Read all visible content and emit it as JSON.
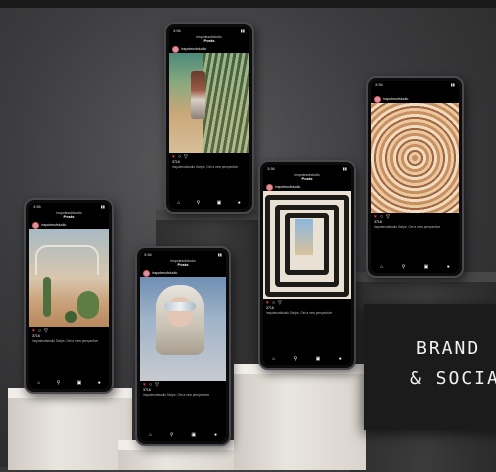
{
  "panel": {
    "line1": "BRAND",
    "line2": "& SOCIA"
  },
  "post": {
    "account": "inspotesofstudio",
    "header_title": "Posts",
    "likes": "3716",
    "caption": "inspotesofstudio Swipe, Get a new perspective",
    "time": "3:56"
  },
  "icons": [
    "heart-icon",
    "comment-icon",
    "share-icon",
    "home-icon",
    "search-icon",
    "reels-icon",
    "profile-icon"
  ],
  "colors": {
    "background": "#3d3d3f",
    "pedestal_light": "#e9e5df",
    "pedestal_dark": "#3b3b3c",
    "like_red": "#e33333"
  }
}
